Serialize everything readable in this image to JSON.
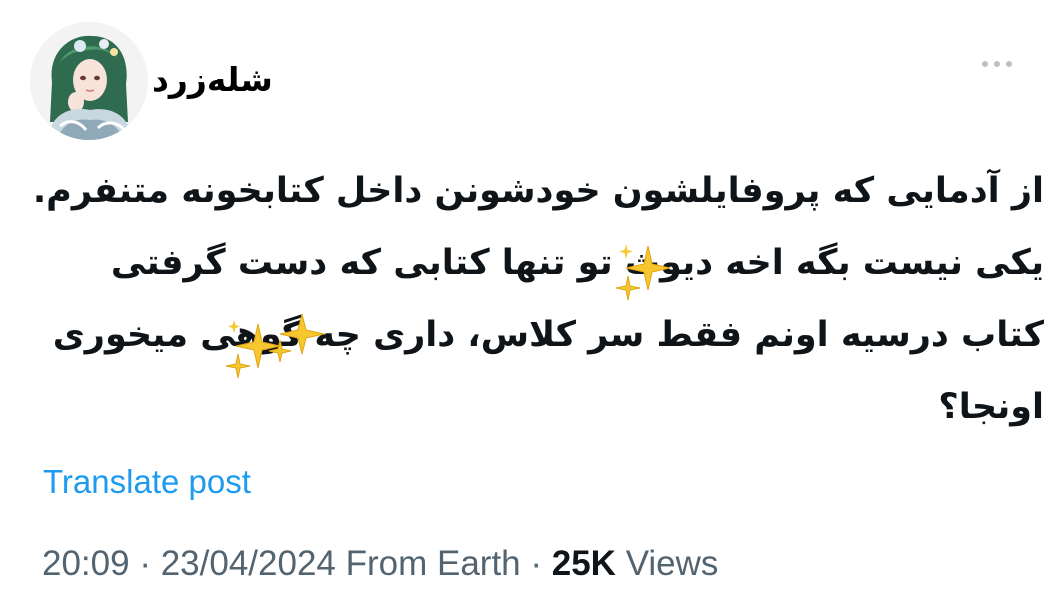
{
  "author": {
    "display_name": "شله‌زرد",
    "avatar_icon": "avatar-illustration"
  },
  "menu": {
    "more_icon": "more-horizontal-icon"
  },
  "post": {
    "lines": [
      "از آدمایی که پروفایلشون خودشونن داخل کتابخونه متنفرم.",
      "یکی نیست بگه اخه دیوث تو تنها کتابی که دست گرفتی",
      "کتاب درسیه اونم فقط سر کلاس، داری چه گوهی میخوری",
      "اونجا؟"
    ],
    "sparkle_icon": "sparkles-icon"
  },
  "translate_label": "Translate post",
  "meta": {
    "time": "20:09",
    "sep1": " · ",
    "date": "23/04/2024",
    "source": " From Earth",
    "sep2": " · ",
    "views_count": "25K",
    "views_label": " Views"
  },
  "colors": {
    "link": "#1d9bf0",
    "secondary_text": "#536471",
    "primary_text": "#0f1419"
  }
}
